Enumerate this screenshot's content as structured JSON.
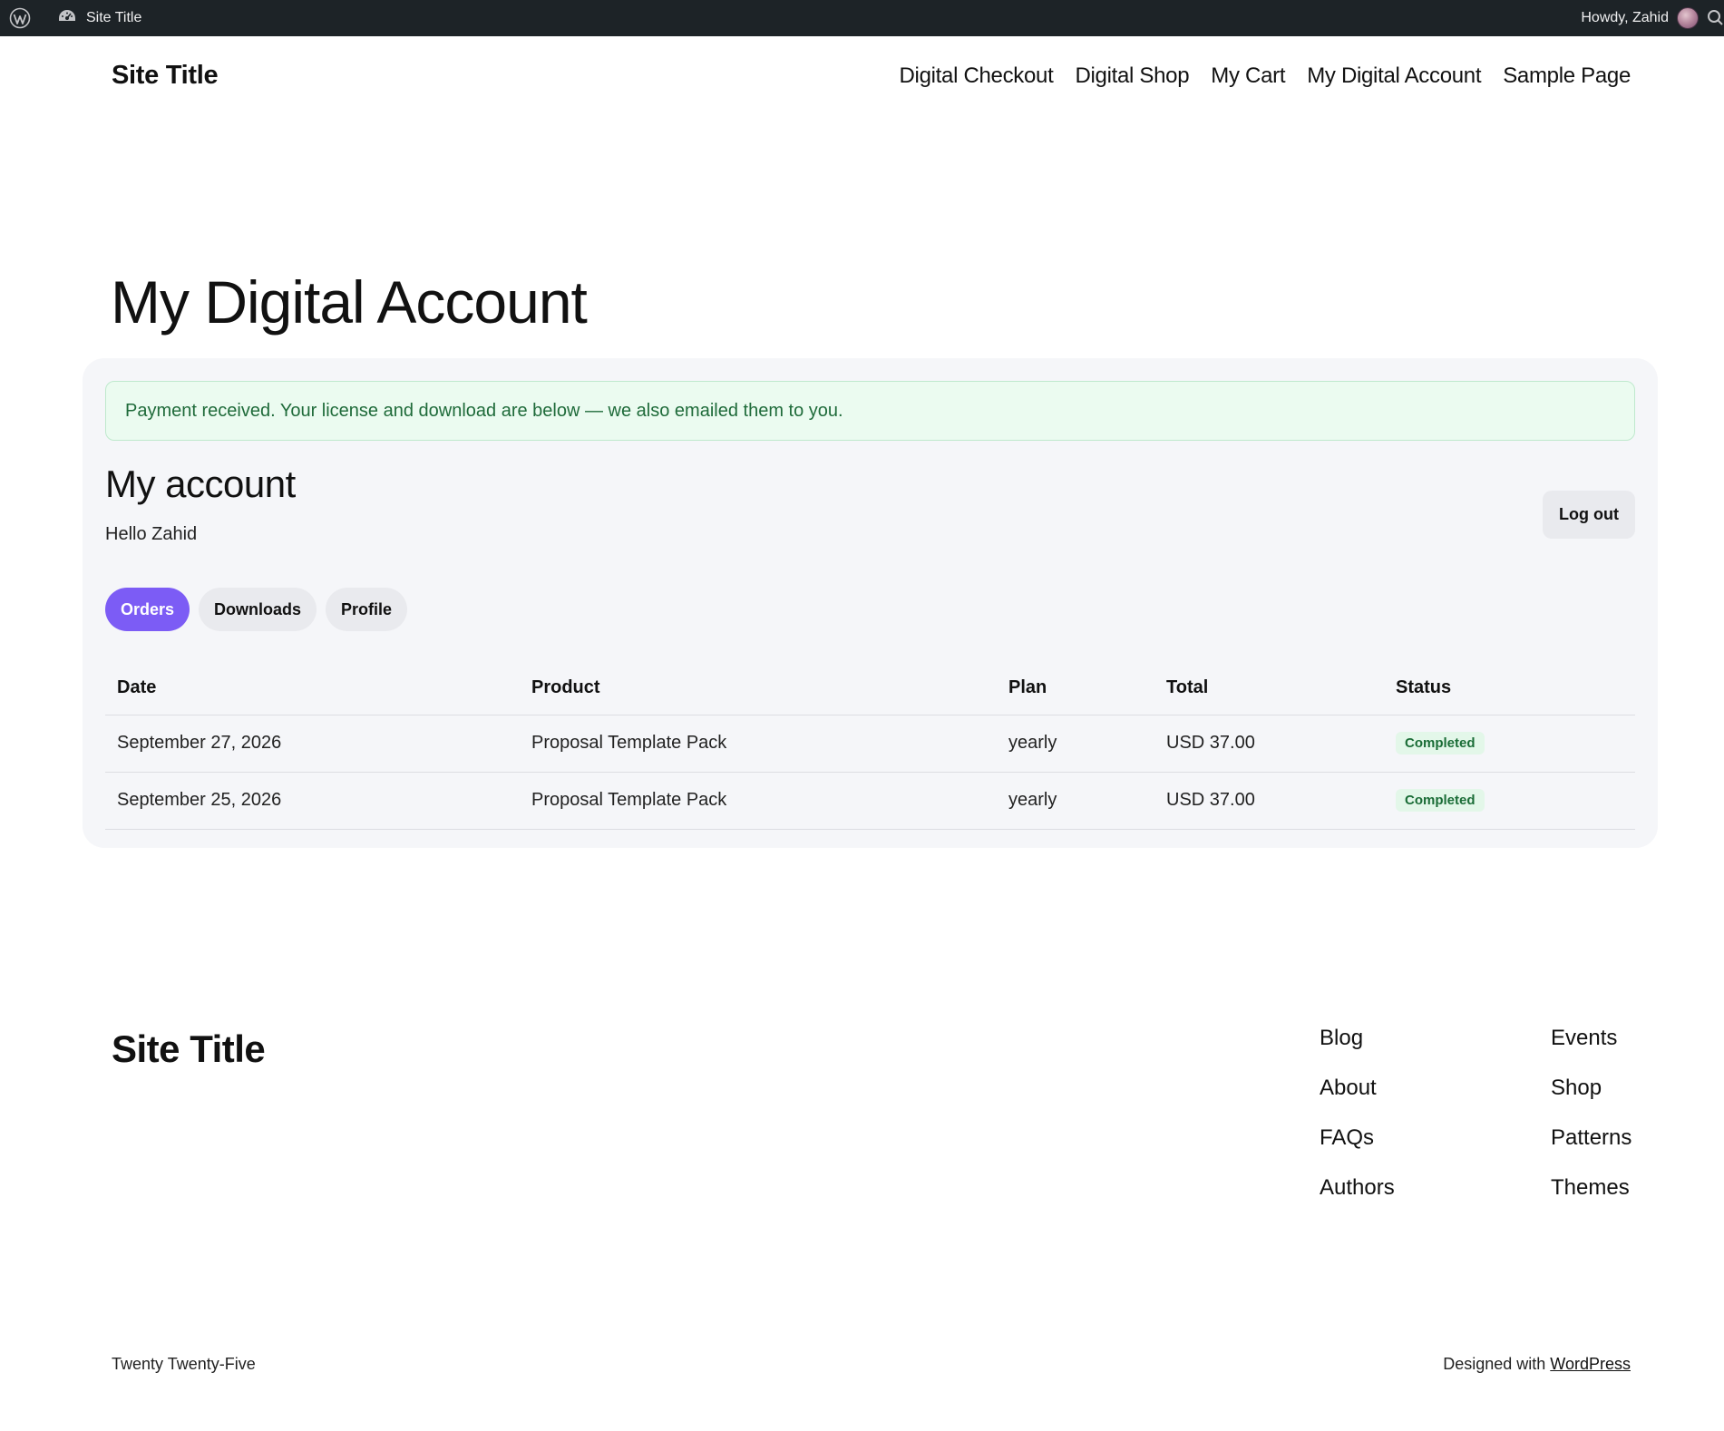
{
  "admin_bar": {
    "site_title": "Site Title",
    "greeting": "Howdy, Zahid"
  },
  "header": {
    "site_title": "Site Title",
    "nav": [
      "Digital Checkout",
      "Digital Shop",
      "My Cart",
      "My Digital Account",
      "Sample Page"
    ]
  },
  "page": {
    "title": "My Digital Account"
  },
  "account": {
    "notice": "Payment received. Your license and download are below — we also emailed them to you.",
    "heading": "My account",
    "hello": "Hello Zahid",
    "logout_label": "Log out",
    "tabs": [
      {
        "label": "Orders",
        "active": true
      },
      {
        "label": "Downloads",
        "active": false
      },
      {
        "label": "Profile",
        "active": false
      }
    ],
    "table": {
      "columns": [
        "Date",
        "Product",
        "Plan",
        "Total",
        "Status"
      ],
      "rows": [
        {
          "date": "September 27, 2026",
          "product": "Proposal Template Pack",
          "plan": "yearly",
          "total": "USD 37.00",
          "status": "Completed"
        },
        {
          "date": "September 25, 2026",
          "product": "Proposal Template Pack",
          "plan": "yearly",
          "total": "USD 37.00",
          "status": "Completed"
        }
      ]
    }
  },
  "footer": {
    "site_title": "Site Title",
    "links_col1": [
      "Blog",
      "About",
      "FAQs",
      "Authors"
    ],
    "links_col2": [
      "Events",
      "Shop",
      "Patterns",
      "Themes"
    ],
    "theme_name": "Twenty Twenty-Five",
    "designed_with": "Designed with",
    "wordpress_link": "WordPress"
  },
  "colors": {
    "admin_bar_bg": "#1d2327",
    "active_tab": "#7c5cf5",
    "notice_bg": "#ebfbf0",
    "card_bg": "#f5f6f9"
  },
  "icons": [
    "wordpress-logo-icon",
    "dashboard-icon",
    "avatar",
    "search-icon"
  ]
}
